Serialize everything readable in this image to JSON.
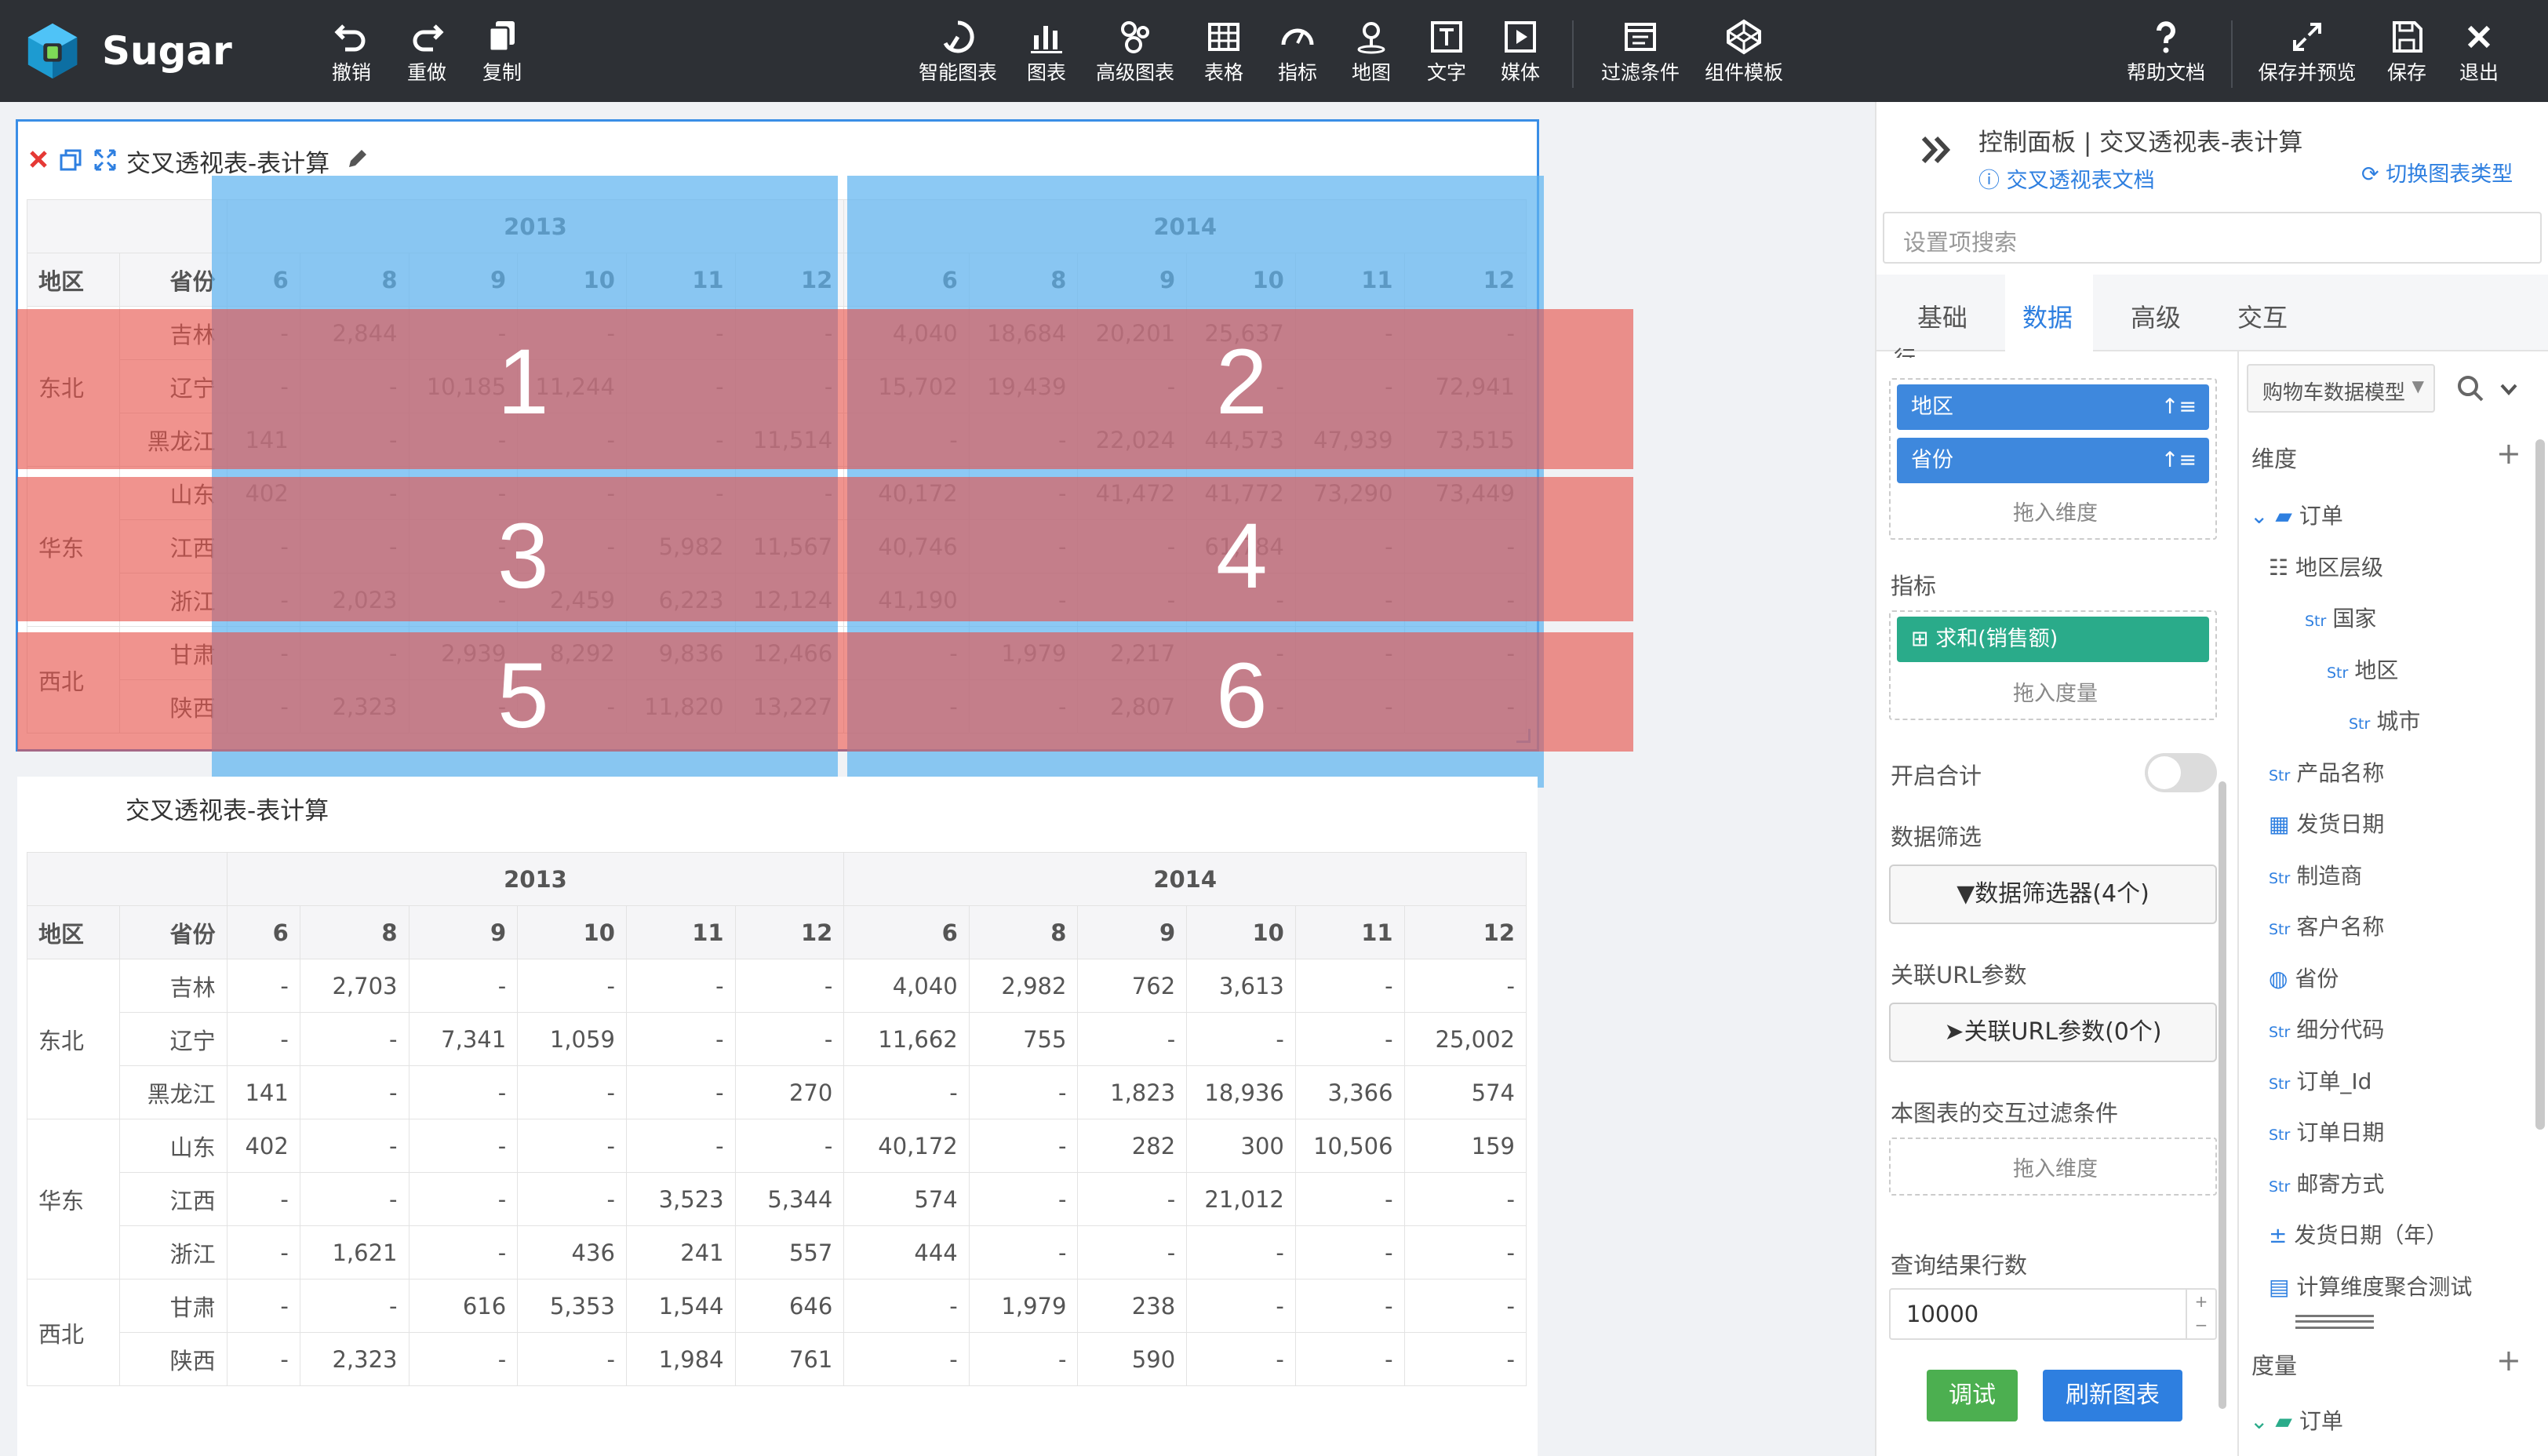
{
  "app": {
    "name": "Sugar"
  },
  "toolbar": {
    "left": [
      {
        "label": "撤销"
      },
      {
        "label": "重做"
      },
      {
        "label": "复制"
      }
    ],
    "center": [
      {
        "label": "智能图表"
      },
      {
        "label": "图表"
      },
      {
        "label": "高级图表"
      },
      {
        "label": "表格"
      },
      {
        "label": "指标"
      },
      {
        "label": "地图"
      },
      {
        "label": "文字"
      },
      {
        "label": "媒体"
      },
      {
        "label": "过滤条件"
      },
      {
        "label": "组件模板"
      }
    ],
    "right": [
      {
        "label": "帮助文档"
      },
      {
        "label": "保存并预览"
      },
      {
        "label": "保存"
      },
      {
        "label": "退出"
      }
    ]
  },
  "widget1": {
    "title": "交叉透视表-表计算"
  },
  "widget2": {
    "title": "交叉透视表-表计算"
  },
  "pivot_headers": {
    "region": "地区",
    "province": "省份",
    "years": [
      "2013",
      "2014"
    ],
    "months": [
      "6",
      "8",
      "9",
      "10",
      "11",
      "12",
      "6",
      "8",
      "9",
      "10",
      "11",
      "12"
    ]
  },
  "table1": {
    "groups": [
      {
        "region": "东北",
        "rows": [
          {
            "province": "吉林",
            "values": [
              "-",
              "2,844",
              "-",
              "-",
              "-",
              "-",
              "4,040",
              "18,684",
              "20,201",
              "25,637",
              "-",
              "-"
            ]
          },
          {
            "province": "辽宁",
            "values": [
              "-",
              "-",
              "10,185",
              "11,244",
              "-",
              "-",
              "15,702",
              "19,439",
              "-",
              "-",
              "-",
              "72,941"
            ]
          },
          {
            "province": "黑龙江",
            "values": [
              "141",
              "-",
              "-",
              "-",
              "-",
              "11,514",
              "-",
              "-",
              "22,024",
              "44,573",
              "47,939",
              "73,515"
            ]
          }
        ]
      },
      {
        "region": "华东",
        "rows": [
          {
            "province": "山东",
            "values": [
              "402",
              "-",
              "-",
              "-",
              "-",
              "-",
              "40,172",
              "-",
              "41,472",
              "41,772",
              "73,290",
              "73,449"
            ]
          },
          {
            "province": "江西",
            "values": [
              "-",
              "-",
              "-",
              "-",
              "5,982",
              "11,567",
              "40,746",
              "-",
              "-",
              "61,784",
              "-",
              "-"
            ]
          },
          {
            "province": "浙江",
            "values": [
              "-",
              "2,023",
              "-",
              "2,459",
              "6,223",
              "12,124",
              "41,190",
              "-",
              "-",
              "-",
              "-",
              "-"
            ]
          }
        ]
      },
      {
        "region": "西北",
        "rows": [
          {
            "province": "甘肃",
            "values": [
              "-",
              "-",
              "2,939",
              "8,292",
              "9,836",
              "12,466",
              "-",
              "1,979",
              "2,217",
              "-",
              "-",
              "-"
            ]
          },
          {
            "province": "陕西",
            "values": [
              "-",
              "2,323",
              "-",
              "-",
              "11,820",
              "13,227",
              "-",
              "-",
              "2,807",
              "-",
              "-",
              "-"
            ]
          }
        ]
      }
    ]
  },
  "table2": {
    "groups": [
      {
        "region": "东北",
        "rows": [
          {
            "province": "吉林",
            "values": [
              "-",
              "2,703",
              "-",
              "-",
              "-",
              "-",
              "4,040",
              "2,982",
              "762",
              "3,613",
              "-",
              "-"
            ]
          },
          {
            "province": "辽宁",
            "values": [
              "-",
              "-",
              "7,341",
              "1,059",
              "-",
              "-",
              "11,662",
              "755",
              "-",
              "-",
              "-",
              "25,002"
            ]
          },
          {
            "province": "黑龙江",
            "values": [
              "141",
              "-",
              "-",
              "-",
              "-",
              "270",
              "-",
              "-",
              "1,823",
              "18,936",
              "3,366",
              "574"
            ]
          }
        ]
      },
      {
        "region": "华东",
        "rows": [
          {
            "province": "山东",
            "values": [
              "402",
              "-",
              "-",
              "-",
              "-",
              "-",
              "40,172",
              "-",
              "282",
              "300",
              "10,506",
              "159"
            ]
          },
          {
            "province": "江西",
            "values": [
              "-",
              "-",
              "-",
              "-",
              "3,523",
              "5,344",
              "574",
              "-",
              "-",
              "21,012",
              "-",
              "-"
            ]
          },
          {
            "province": "浙江",
            "values": [
              "-",
              "1,621",
              "-",
              "436",
              "241",
              "557",
              "444",
              "-",
              "-",
              "-",
              "-",
              "-"
            ]
          }
        ]
      },
      {
        "region": "西北",
        "rows": [
          {
            "province": "甘肃",
            "values": [
              "-",
              "-",
              "616",
              "5,353",
              "1,544",
              "646",
              "-",
              "1,979",
              "238",
              "-",
              "-",
              "-"
            ]
          },
          {
            "province": "陕西",
            "values": [
              "-",
              "2,323",
              "-",
              "-",
              "1,984",
              "761",
              "-",
              "-",
              "590",
              "-",
              "-",
              "-"
            ]
          }
        ]
      }
    ]
  },
  "overlay_numbers": [
    "1",
    "2",
    "3",
    "4",
    "5",
    "6"
  ],
  "panel": {
    "title": "控制面板 | 交叉透视表-表计算",
    "doc_link": "交叉透视表文档",
    "switch_type": "切换图表类型",
    "search_placeholder": "设置项搜索",
    "tabs": [
      "基础",
      "数据",
      "高级",
      "交互"
    ],
    "active_tab": "数据",
    "row_label": "行",
    "row_fields": [
      "地区",
      "省份"
    ],
    "drop_dimension": "拖入维度",
    "measure_label": "指标",
    "measure_field": "求和(销售额)",
    "drop_measure": "拖入度量",
    "total_label": "开启合计",
    "filter_label": "数据筛选",
    "filter_button": "数据筛选器(4个)",
    "url_label": "关联URL参数",
    "url_button": "关联URL参数(0个)",
    "interaction_label": "本图表的交互过滤条件",
    "drop_dimension2": "拖入维度",
    "query_rows_label": "查询结果行数",
    "query_rows_value": "10000",
    "debug_button": "调试",
    "refresh_button": "刷新图表",
    "model_select": "购物车数据模型",
    "dimension_header": "维度",
    "measure_header": "度量",
    "str_tag": "Str",
    "dimension_tree": [
      {
        "label": "订单",
        "kind": "folder",
        "indent": 0
      },
      {
        "label": "地区层级",
        "kind": "hierarchy",
        "indent": 1
      },
      {
        "label": "国家",
        "kind": "str",
        "indent": 2
      },
      {
        "label": "地区",
        "kind": "str",
        "indent": 3
      },
      {
        "label": "城市",
        "kind": "str",
        "indent": 4
      },
      {
        "label": "产品名称",
        "kind": "str",
        "indent": 1
      },
      {
        "label": "发货日期",
        "kind": "date",
        "indent": 1
      },
      {
        "label": "制造商",
        "kind": "str",
        "indent": 1
      },
      {
        "label": "客户名称",
        "kind": "str",
        "indent": 1
      },
      {
        "label": "省份",
        "kind": "geo",
        "indent": 1
      },
      {
        "label": "细分代码",
        "kind": "str",
        "indent": 1
      },
      {
        "label": "订单_Id",
        "kind": "str",
        "indent": 1
      },
      {
        "label": "订单日期",
        "kind": "str",
        "indent": 1
      },
      {
        "label": "邮寄方式",
        "kind": "str",
        "indent": 1
      },
      {
        "label": "发货日期（年）",
        "kind": "calc",
        "indent": 1
      },
      {
        "label": "计算维度聚合测试",
        "kind": "calc2",
        "indent": 1
      }
    ],
    "measure_tree": [
      {
        "label": "订单",
        "kind": "folder",
        "indent": 0
      }
    ]
  },
  "colors": {
    "topbar": "#2d3035",
    "accent": "#2e7fe0",
    "green_pill": "#2aab8a",
    "debug": "#4caf50",
    "overlay_blue": "#5fb4f0",
    "overlay_red": "#e8544b"
  }
}
